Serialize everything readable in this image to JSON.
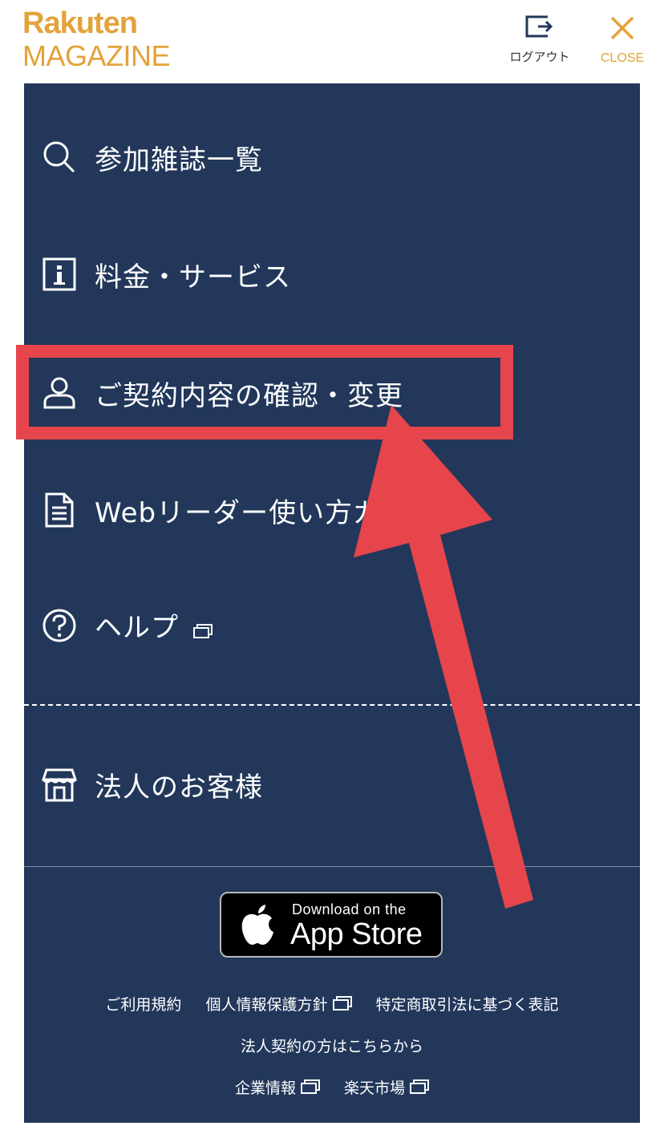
{
  "header": {
    "logo_top": "Rakuten",
    "logo_bottom": "MAGAZINE",
    "logout_label": "ログアウト",
    "close_label": "CLOSE"
  },
  "menu": {
    "items": [
      {
        "label": "参加雑誌一覧",
        "icon": "search-icon"
      },
      {
        "label": "料金・サービス",
        "icon": "info-icon"
      },
      {
        "label": "ご契約内容の確認・変更",
        "icon": "user-icon"
      },
      {
        "label": "Webリーダー使い方ガ",
        "icon": "document-icon"
      },
      {
        "label": "ヘルプ",
        "icon": "help-icon"
      },
      {
        "label": "法人のお客様",
        "icon": "store-icon"
      }
    ]
  },
  "appstore": {
    "small": "Download on the",
    "big": "App Store"
  },
  "footer": {
    "terms": "ご利用規約",
    "privacy": "個人情報保護方針",
    "commerce": "特定商取引法に基づく表記",
    "corporate_contract": "法人契約の方はこちらから",
    "company": "企業情報",
    "ichiba": "楽天市場"
  },
  "colors": {
    "brand": "#e3a23a",
    "panel": "#22375a",
    "annotation": "#e5454b"
  }
}
